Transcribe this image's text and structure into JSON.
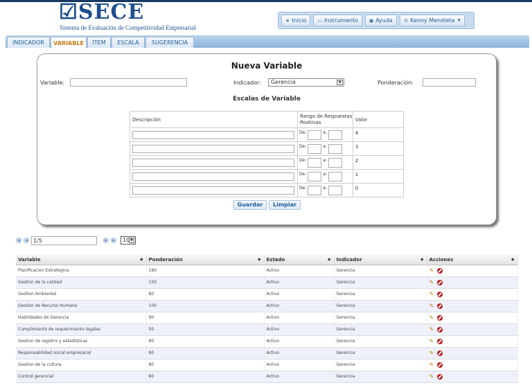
{
  "app": {
    "logo_text": "SECE",
    "logo_subtitle": "Sistema de Evaluación de Competitividad Empresarial"
  },
  "topnav": {
    "inicio": "Inicio",
    "instrumento": "Instrumento",
    "ayuda": "Ayuda",
    "user": "Kenny Mendieta"
  },
  "tabs": [
    "INDICADOR",
    "VARIABLE",
    "ITEM",
    "ESCALA",
    "SUGERENCIA"
  ],
  "active_tab": "VARIABLE",
  "form": {
    "title": "Nueva Variable",
    "variable_label": "Variable:",
    "variable_value": "",
    "indicador_label": "Indicador:",
    "indicador_value": "Gerencia",
    "ponderacion_label": "Ponderación:",
    "ponderacion_value": "",
    "scales_title": "Escalas de Variable",
    "scale_headers": {
      "descripcion": "Descripción",
      "rango": "Rango de Respuestas Positivas",
      "valor": "Valor"
    },
    "range_de": "De:",
    "range_a": "a:",
    "scale_values": [
      "4",
      "3",
      "2",
      "1",
      "0"
    ],
    "guardar": "Guardar",
    "limpiar": "Limpiar"
  },
  "pager": {
    "page": "1/5",
    "rows_per_page": "10"
  },
  "grid": {
    "headers": [
      "Variable",
      "Ponderación",
      "Estado",
      "Indicador",
      "Acciones"
    ],
    "rows": [
      [
        "Planificacion Estrategica",
        "180",
        "Activo",
        "Gerencia"
      ],
      [
        "Gestion de la calidad",
        "150",
        "Activo",
        "Gerencia"
      ],
      [
        "Gestion Ambiental",
        "80",
        "Activo",
        "Gerencia"
      ],
      [
        "Gestion de Recurso Humano",
        "100",
        "Activo",
        "Gerencia"
      ],
      [
        "Habilidades de Gerencia",
        "90",
        "Activo",
        "Gerencia"
      ],
      [
        "Cumplimiento de requerimiento legales",
        "50",
        "Activo",
        "Gerencia"
      ],
      [
        "Gestion de registro y estadisticas",
        "80",
        "Activo",
        "Gerencia"
      ],
      [
        "Responsabilidad social empresarial",
        "80",
        "Activo",
        "Gerencia"
      ],
      [
        "Gestion de la cultura",
        "80",
        "Activo",
        "Gerencia"
      ],
      [
        "Control gerencial",
        "60",
        "Activo",
        "Gerencia"
      ]
    ]
  },
  "colors": {
    "brand": "#1e4f8e",
    "active_tab_text": "#c07a12",
    "delete_icon": "#c0161a"
  }
}
